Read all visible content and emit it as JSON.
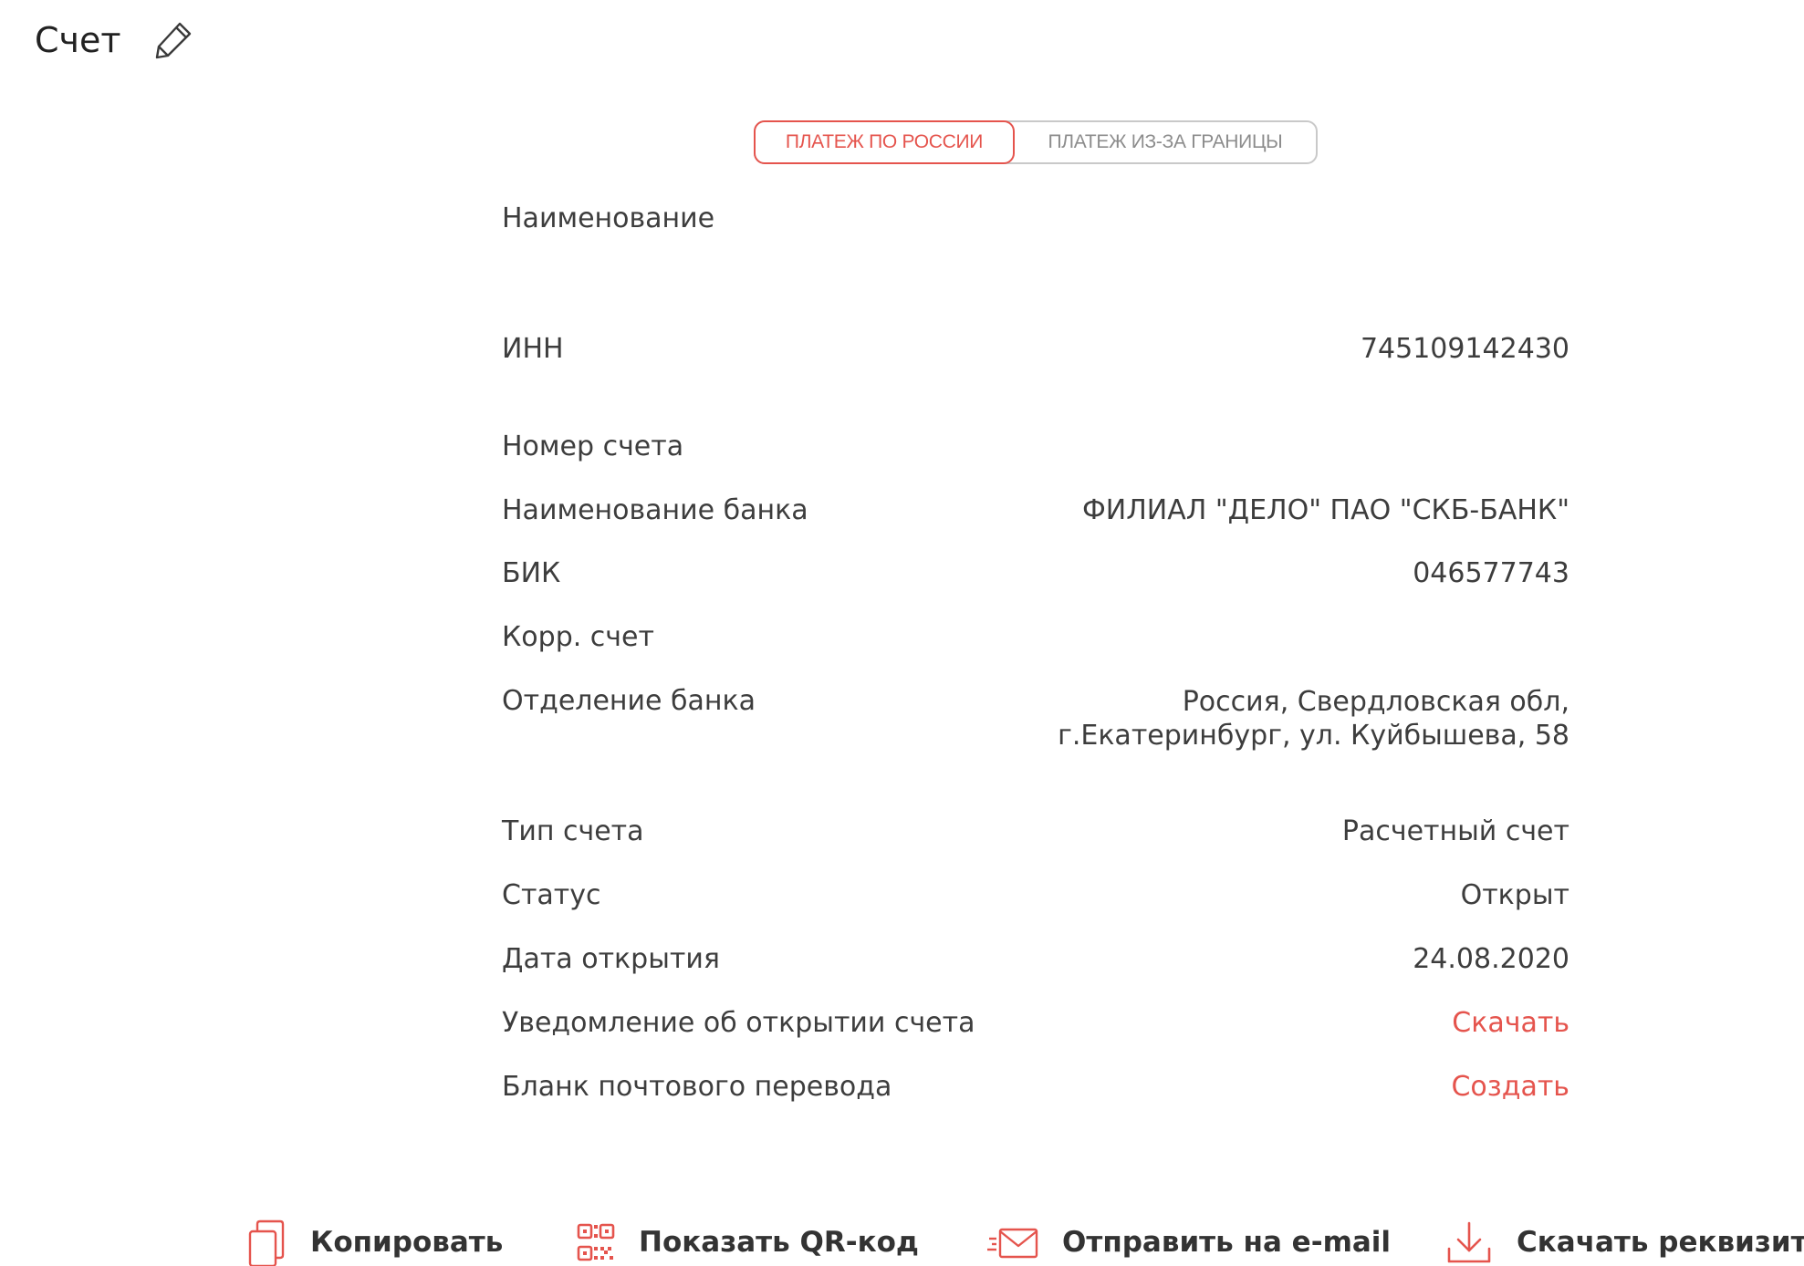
{
  "header": {
    "title": "Счет"
  },
  "payment_tabs": [
    {
      "label": "ПЛАТЕЖ ПО РОССИИ",
      "active": true
    },
    {
      "label": "ПЛАТЕЖ ИЗ-ЗА ГРАНИЦЫ",
      "active": false
    }
  ],
  "details": {
    "name": {
      "label": "Наименование",
      "value": ""
    },
    "inn": {
      "label": "ИНН",
      "value": "745109142430"
    },
    "account_number": {
      "label": "Номер счета",
      "value": ""
    },
    "bank_name": {
      "label": "Наименование банка",
      "value": "ФИЛИАЛ \"ДЕЛО\" ПАО \"СКБ-БАНК\""
    },
    "bik": {
      "label": "БИК",
      "value": "046577743"
    },
    "corr_account": {
      "label": "Корр. счет",
      "value": ""
    },
    "branch": {
      "label": "Отделение банка",
      "value": "Россия, Свердловская обл, г.Екатеринбург, ул. Куйбышева, 58"
    },
    "account_type": {
      "label": "Тип счета",
      "value": "Расчетный счет"
    },
    "status": {
      "label": "Статус",
      "value": "Открыт"
    },
    "open_date": {
      "label": "Дата открытия",
      "value": "24.08.2020"
    },
    "open_notice": {
      "label": "Уведомление об открытии счета",
      "value": "Скачать"
    },
    "postal_form": {
      "label": "Бланк почтового перевода",
      "value": "Создать"
    }
  },
  "actions": {
    "copy": "Копировать",
    "qr": "Показать QR-код",
    "email": "Отправить на e-mail",
    "download": "Скачать реквизиты"
  },
  "colors": {
    "accent": "#e5544d",
    "text": "#3d3d3d",
    "muted": "#8c8c8c"
  }
}
